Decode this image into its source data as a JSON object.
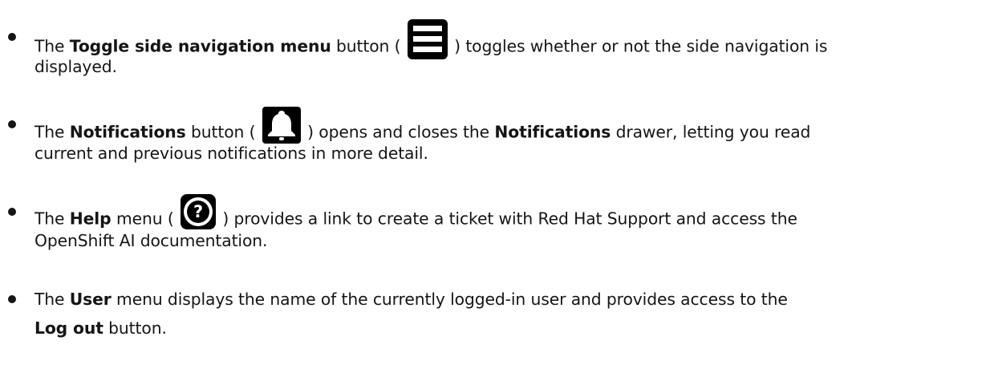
{
  "items": [
    {
      "line1": {
        "pre": "The ",
        "bold": "Toggle side navigation menu",
        "mid": " button ( ",
        "post": " ) toggles whether or not the side navigation is"
      },
      "line2": "displayed.",
      "icon": "menu-icon"
    },
    {
      "line1": {
        "pre": "The ",
        "bold": "Notifications",
        "mid": " button ( ",
        "post": " ) opens and closes the ",
        "bold2": "Notifications",
        "post2": " drawer, letting you read"
      },
      "line2": "current and previous notifications in more detail.",
      "icon": "bell-icon"
    },
    {
      "line1": {
        "pre": "The ",
        "bold": "Help",
        "mid": " menu ( ",
        "post": " ) provides a link to create a ticket with Red Hat Support and access the"
      },
      "line2": "OpenShift AI documentation.",
      "icon": "help-icon",
      "icon_glyph": "?"
    },
    {
      "line1": {
        "pre": "The ",
        "bold": "User",
        "post": " menu displays the name of the currently logged-in user and provides access to the"
      },
      "line2": {
        "bold": "Log out",
        "post": " button."
      }
    }
  ]
}
